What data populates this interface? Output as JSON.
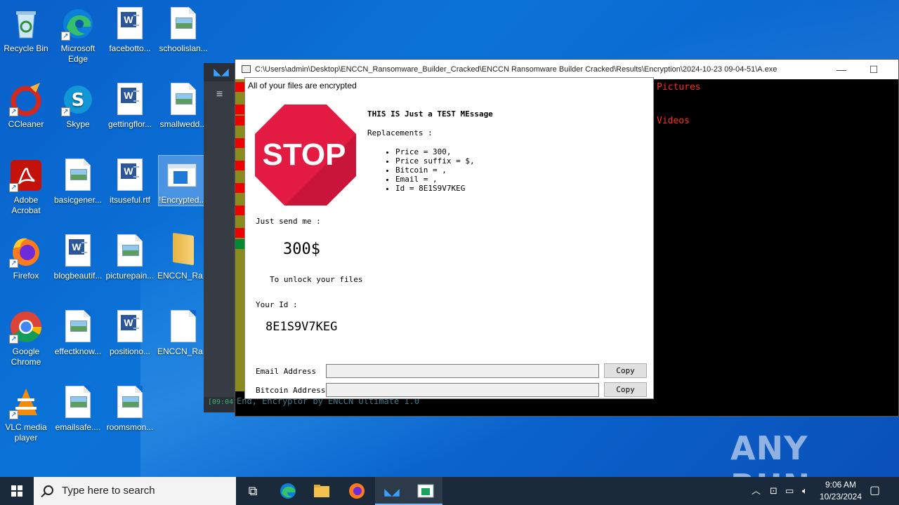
{
  "desktop_icons": [
    {
      "label": "Recycle Bin",
      "icon": "recycle-bin-icon"
    },
    {
      "label": "Microsoft Edge",
      "icon": "edge-icon"
    },
    {
      "label": "facebotto...",
      "icon": "word-doc-icon"
    },
    {
      "label": "schoolislan...",
      "icon": "image-file-icon"
    },
    {
      "label": "CCleaner",
      "icon": "ccleaner-icon"
    },
    {
      "label": "Skype",
      "icon": "skype-icon"
    },
    {
      "label": "gettingflor...",
      "icon": "word-doc-icon"
    },
    {
      "label": "smallwedd...",
      "icon": "image-file-icon"
    },
    {
      "label": "Adobe Acrobat",
      "icon": "acrobat-icon"
    },
    {
      "label": "basicgener...",
      "icon": "image-file-icon"
    },
    {
      "label": "itsuseful.rtf",
      "icon": "word-doc-icon"
    },
    {
      "label": "!Encrypted...",
      "icon": "html-file-icon"
    },
    {
      "label": "Firefox",
      "icon": "firefox-icon"
    },
    {
      "label": "blogbeautif...",
      "icon": "word-doc-icon"
    },
    {
      "label": "picturepain...",
      "icon": "image-file-icon"
    },
    {
      "label": "ENCCN_Ra...",
      "icon": "folder-icon"
    },
    {
      "label": "Google Chrome",
      "icon": "chrome-icon"
    },
    {
      "label": "effectknow...",
      "icon": "image-file-icon"
    },
    {
      "label": "positiono...",
      "icon": "word-doc-icon"
    },
    {
      "label": "ENCCN_Ra...",
      "icon": "blank-file-icon"
    },
    {
      "label": "VLC media player",
      "icon": "vlc-icon"
    },
    {
      "label": "emailsafe....",
      "icon": "image-file-icon"
    },
    {
      "label": "roomsmon...",
      "icon": "image-file-icon"
    }
  ],
  "dark_app": {
    "time_fragment": "[09:04:"
  },
  "console": {
    "title": "C:\\Users\\admin\\Desktop\\ENCCN_Ransomware_Builder_Cracked\\ENCCN Ransomware Builder Cracked\\Results\\Encryption\\2024-10-23 09-04-51\\A.exe",
    "folder_labels": [
      "Pictures",
      "Videos"
    ],
    "bottom_line": "End, Encryptor by ENCCN Ultimate 1.0"
  },
  "dialog": {
    "title": "All of your files are encrypted",
    "stop_sign_text": "STOP",
    "heading": "THIS IS Just a TEST MEssage",
    "replacements_label": "Replacements :",
    "replacements": [
      "Price = 300,",
      "Price suffix = $,",
      "Bitcoin = ,",
      "Email = ,",
      "Id = 8E1S9V7KEG"
    ],
    "send_label": "Just send me :",
    "amount": "300$",
    "unlock_text": "To unlock your files",
    "id_label": "Your Id :",
    "id_value": "8E1S9V7KEG",
    "email_label": "Email Address",
    "email_value": "",
    "bitcoin_label": "Bitcoin Address",
    "bitcoin_value": "",
    "copy_label": "Copy"
  },
  "watermark": "ANY RUN",
  "taskbar": {
    "search_placeholder": "Type here to search",
    "time": "9:06 AM",
    "date": "10/23/2024"
  }
}
